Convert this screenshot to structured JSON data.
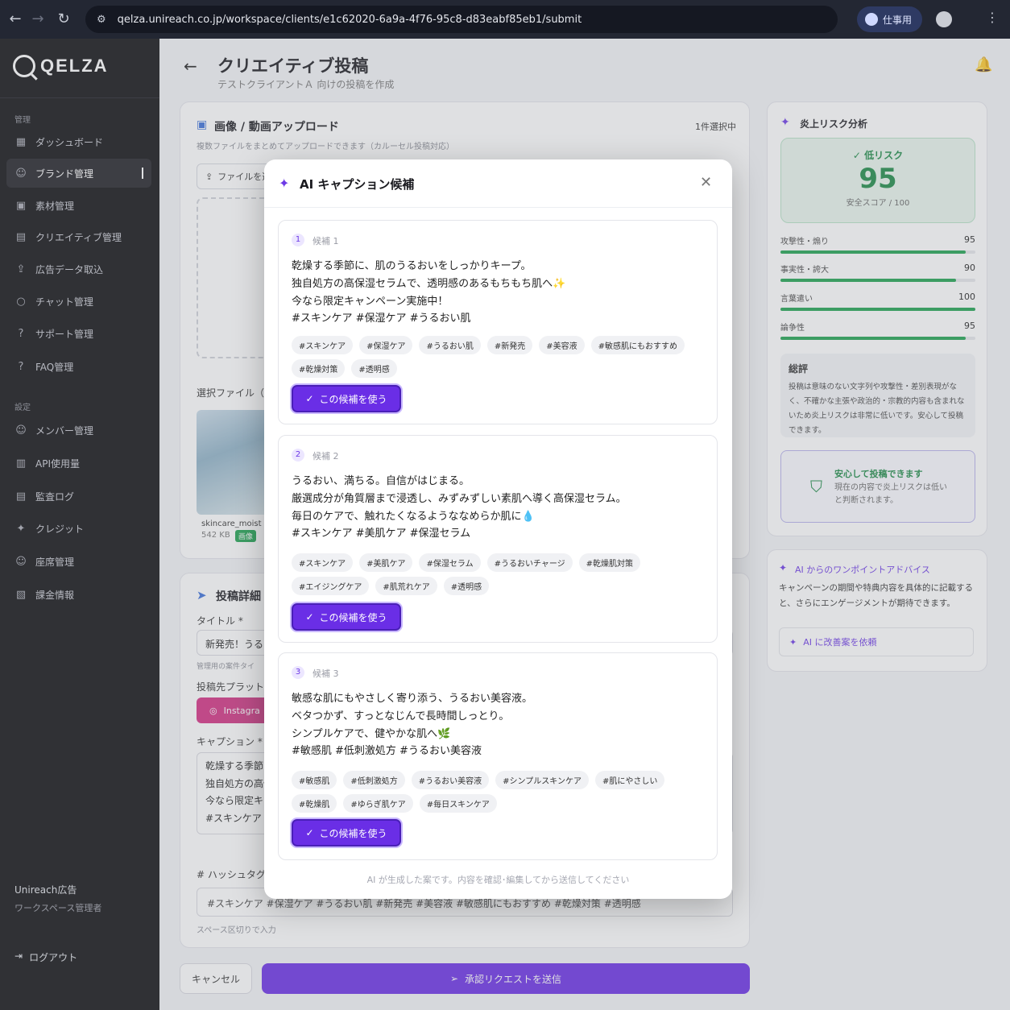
{
  "browser": {
    "url": "qelza.unireach.co.jp/workspace/clients/e1c62020-6a9a-4f76-95c8-d83eabf85eb1/submit",
    "profile_label": "仕事用"
  },
  "sidebar": {
    "logo": "QELZA",
    "section_manage": "管理",
    "section_settings": "設定",
    "items_manage": [
      {
        "label": "ダッシュボード",
        "icon": "grid-icon"
      },
      {
        "label": "ブランド管理",
        "icon": "users-icon"
      },
      {
        "label": "素材管理",
        "icon": "image-icon"
      },
      {
        "label": "クリエイティブ管理",
        "icon": "file-check-icon"
      },
      {
        "label": "広告データ取込",
        "icon": "upload-icon"
      },
      {
        "label": "チャット管理",
        "icon": "chat-icon"
      },
      {
        "label": "サポート管理",
        "icon": "help-icon"
      },
      {
        "label": "FAQ管理",
        "icon": "question-icon"
      }
    ],
    "items_settings": [
      {
        "label": "メンバー管理",
        "icon": "users-icon"
      },
      {
        "label": "API使用量",
        "icon": "bar-chart-icon"
      },
      {
        "label": "監査ログ",
        "icon": "log-icon"
      },
      {
        "label": "クレジット",
        "icon": "sparkle-icon"
      },
      {
        "label": "座席管理",
        "icon": "seat-icon"
      },
      {
        "label": "課金情報",
        "icon": "billing-icon"
      }
    ],
    "org_name": "Unireach広告",
    "org_role": "ワークスペース管理者",
    "logout": "ログアウト"
  },
  "header": {
    "title": "クリエイティブ投稿",
    "subtitle": "テストクライアントＡ 向けの投稿を作成"
  },
  "upload": {
    "title": "画像 / 動画アップロード",
    "selected_count": "1件選択中",
    "hint": "複数ファイルをまとめてアップロードできます（カルーセル投稿対応）",
    "file_button": "ファイルを選",
    "selected_label": "選択ファイル（1",
    "file_name": "skincare_moist",
    "file_size": "542 KB",
    "file_badge": "画像"
  },
  "post": {
    "title": "投稿詳細",
    "title_label": "タイトル *",
    "title_value": "新発売！うる",
    "title_hint": "管理用の案件タイ",
    "platform_label": "投稿先プラットフ",
    "platform_chip": "Instagra",
    "caption_label": "キャプション *",
    "caption_lines": [
      "乾燥する季節に",
      "独自処方の高保",
      "今なら限定キャ",
      "#スキンケア"
    ],
    "hashtag_label": "# ハッシュタグ",
    "hashtags_value": "#スキンケア  #保湿ケア  #うるおい肌  #新発売  #美容液  #敏感肌にもおすすめ  #乾燥対策  #透明感",
    "hashtag_hint": "スペース区切りで入力"
  },
  "actions": {
    "cancel": "キャンセル",
    "submit": "承認リクエストを送信"
  },
  "risk": {
    "title": "炎上リスク分析",
    "level": "低リスク",
    "score": "95",
    "score_caption": "安全スコア / 100",
    "metrics": [
      {
        "label": "攻撃性・煽り",
        "value": 95
      },
      {
        "label": "事実性・誇大",
        "value": 90
      },
      {
        "label": "言葉遣い",
        "value": 100
      },
      {
        "label": "論争性",
        "value": 95
      }
    ],
    "summary_title": "総評",
    "summary_text": "投稿は意味のない文字列や攻撃性・差別表現がなく、不確かな主張や政治的・宗教的内容も含まれないため炎上リスクは非常に低いです。安心して投稿できます。",
    "safe_title": "安心して投稿できます",
    "safe_text": "現在の内容で炎上リスクは低いと判断されます。"
  },
  "advice": {
    "title": "AI からのワンポイントアドバイス",
    "text": "キャンペーンの期間や特典内容を具体的に記載すると、さらにエンゲージメントが期待できます。",
    "button": "AI に改善案を依頼"
  },
  "modal": {
    "title": "AI キャプション候補",
    "use_label": "この候補を使う",
    "footer": "AI が生成した案です。内容を確認･編集してから送信してください",
    "candidates": [
      {
        "num": "1",
        "label": "候補 1",
        "text": "乾燥する季節に、肌のうるおいをしっかりキープ。\n独自処方の高保湿セラムで、透明感のあるもちもち肌へ✨\n今なら限定キャンペーン実施中！\n#スキンケア  #保湿ケア  #うるおい肌",
        "tags": [
          "#スキンケア",
          "#保湿ケア",
          "#うるおい肌",
          "#新発売",
          "#美容液",
          "#敏感肌にもおすすめ",
          "#乾燥対策",
          "#透明感"
        ]
      },
      {
        "num": "2",
        "label": "候補 2",
        "text": "うるおい、満ちる。自信がはじまる。\n厳選成分が角質層まで浸透し、みずみずしい素肌へ導く高保湿セラム。\n毎日のケアで、触れたくなるようななめらか肌に💧\n#スキンケア  #美肌ケア  #保湿セラム",
        "tags": [
          "#スキンケア",
          "#美肌ケア",
          "#保湿セラム",
          "#うるおいチャージ",
          "#乾燥肌対策",
          "#エイジングケア",
          "#肌荒れケア",
          "#透明感"
        ]
      },
      {
        "num": "3",
        "label": "候補 3",
        "text": "敏感な肌にもやさしく寄り添う、うるおい美容液。\nベタつかず、すっとなじんで長時間しっとり。\nシンプルケアで、健やかな肌へ🌿\n#敏感肌  #低刺激処方  #うるおい美容液",
        "tags": [
          "#敏感肌",
          "#低刺激処方",
          "#うるおい美容液",
          "#シンプルスキンケア",
          "#肌にやさしい",
          "#乾燥肌",
          "#ゆらぎ肌ケア",
          "#毎日スキンケア"
        ]
      }
    ]
  }
}
